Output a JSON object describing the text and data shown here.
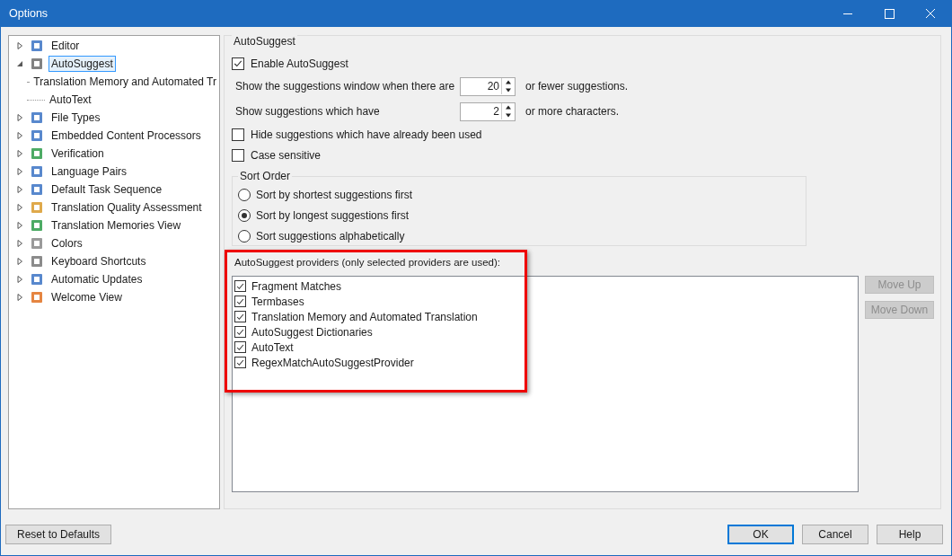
{
  "window": {
    "title": "Options"
  },
  "tree": [
    {
      "label": "Editor",
      "expanded": false,
      "selected": false
    },
    {
      "label": "AutoSuggest",
      "expanded": true,
      "selected": true,
      "children": [
        {
          "label": "Translation Memory and Automated Tr",
          "selected": false
        },
        {
          "label": "AutoText",
          "selected": false
        }
      ]
    },
    {
      "label": "File Types",
      "expanded": false,
      "selected": false
    },
    {
      "label": "Embedded Content Processors",
      "expanded": false,
      "selected": false
    },
    {
      "label": "Verification",
      "expanded": false,
      "selected": false
    },
    {
      "label": "Language Pairs",
      "expanded": false,
      "selected": false
    },
    {
      "label": "Default Task Sequence",
      "expanded": false,
      "selected": false
    },
    {
      "label": "Translation Quality Assessment",
      "expanded": false,
      "selected": false
    },
    {
      "label": "Translation Memories View",
      "expanded": false,
      "selected": false
    },
    {
      "label": "Colors",
      "expanded": false,
      "selected": false
    },
    {
      "label": "Keyboard Shortcuts",
      "expanded": false,
      "selected": false
    },
    {
      "label": "Automatic Updates",
      "expanded": false,
      "selected": false
    },
    {
      "label": "Welcome View",
      "expanded": false,
      "selected": false
    }
  ],
  "panel": {
    "title": "AutoSuggest",
    "enable": {
      "label": "Enable AutoSuggest",
      "checked": true
    },
    "spinners": [
      {
        "label": "Show the suggestions window when there are",
        "value": "20",
        "suffix": "or fewer suggestions."
      },
      {
        "label": "Show suggestions which have",
        "value": "2",
        "suffix": "or more characters."
      }
    ],
    "options": [
      {
        "label": "Hide suggestions which have already been used",
        "checked": false
      },
      {
        "label": "Case sensitive",
        "checked": false
      }
    ],
    "sort_order": {
      "title": "Sort Order",
      "options": [
        {
          "label": "Sort by shortest suggestions first",
          "selected": false
        },
        {
          "label": "Sort by longest suggestions first",
          "selected": true
        },
        {
          "label": "Sort suggestions alphabetically",
          "selected": false
        }
      ]
    },
    "providers": {
      "title": "AutoSuggest providers (only selected providers are used):",
      "highlighted": true,
      "items": [
        {
          "label": "Fragment Matches",
          "checked": true
        },
        {
          "label": "Termbases",
          "checked": true
        },
        {
          "label": "Translation Memory and Automated Translation",
          "checked": true
        },
        {
          "label": "AutoSuggest Dictionaries",
          "checked": true
        },
        {
          "label": "AutoText",
          "checked": true
        },
        {
          "label": "RegexMatchAutoSuggestProvider",
          "checked": true
        }
      ],
      "buttons": [
        {
          "label": "Move Up",
          "disabled": true
        },
        {
          "label": "Move Down",
          "disabled": true
        }
      ]
    }
  },
  "footer": {
    "reset": "Reset to Defaults",
    "buttons": [
      {
        "label": "OK",
        "default": true
      },
      {
        "label": "Cancel",
        "default": false
      },
      {
        "label": "Help",
        "default": false
      }
    ]
  }
}
